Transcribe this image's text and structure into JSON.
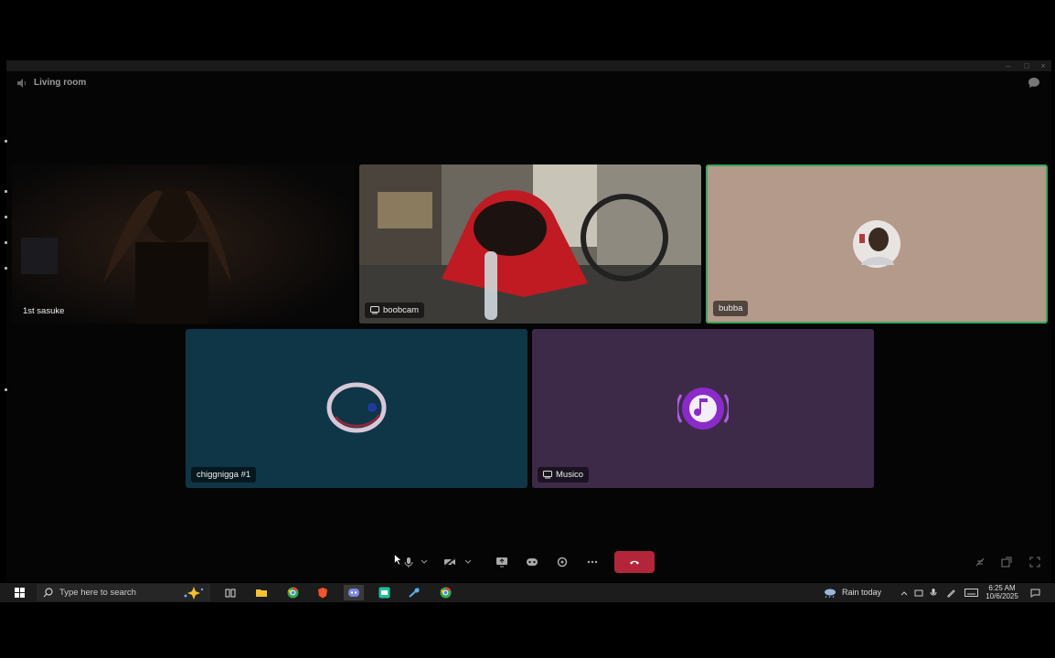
{
  "window": {
    "channel_icon": "speaker-icon",
    "channel_name": "Living room",
    "chat_icon": "chat-bubble-icon",
    "controls": [
      "minimize-icon",
      "maximize-icon",
      "close-icon"
    ]
  },
  "tiles": [
    {
      "id": "sasuke",
      "name": "1st sasuke",
      "type": "video",
      "streaming": false,
      "speaking": false
    },
    {
      "id": "boobcam",
      "name": "boobcam",
      "type": "video",
      "streaming": true,
      "speaking": false
    },
    {
      "id": "bubba",
      "name": "bubba",
      "type": "avatar",
      "streaming": false,
      "speaking": true,
      "bg": "#b49a8a",
      "border": "#3ba55c"
    },
    {
      "id": "chiggnigga",
      "name": "chiggnigga #1",
      "type": "avatar",
      "streaming": false,
      "speaking": false,
      "bg": "#0f3646"
    },
    {
      "id": "musico",
      "name": "Musico",
      "type": "avatar",
      "streaming": true,
      "speaking": false,
      "bg": "#3d2a49"
    }
  ],
  "call_controls": {
    "mic": "microphone-icon",
    "camera": "camera-off-icon",
    "screenshare": "screenshare-icon",
    "activities": "gamepad-icon",
    "soundboard": "soundboard-icon",
    "more": "more-icon",
    "disconnect": "hang-up-icon",
    "disconnect_color": "#b3263a",
    "right": [
      "hide-participants-icon",
      "popout-icon",
      "fullscreen-icon"
    ]
  },
  "taskbar": {
    "search_placeholder": "Type here to search",
    "weather": "Rain today",
    "time": "6:25 AM",
    "date": "10/6/2025",
    "apps": [
      "task-view-icon",
      "file-explorer-icon",
      "chrome-icon",
      "brave-icon",
      "discord-icon",
      "app-icon",
      "steam-icon",
      "chrome-icon"
    ]
  }
}
